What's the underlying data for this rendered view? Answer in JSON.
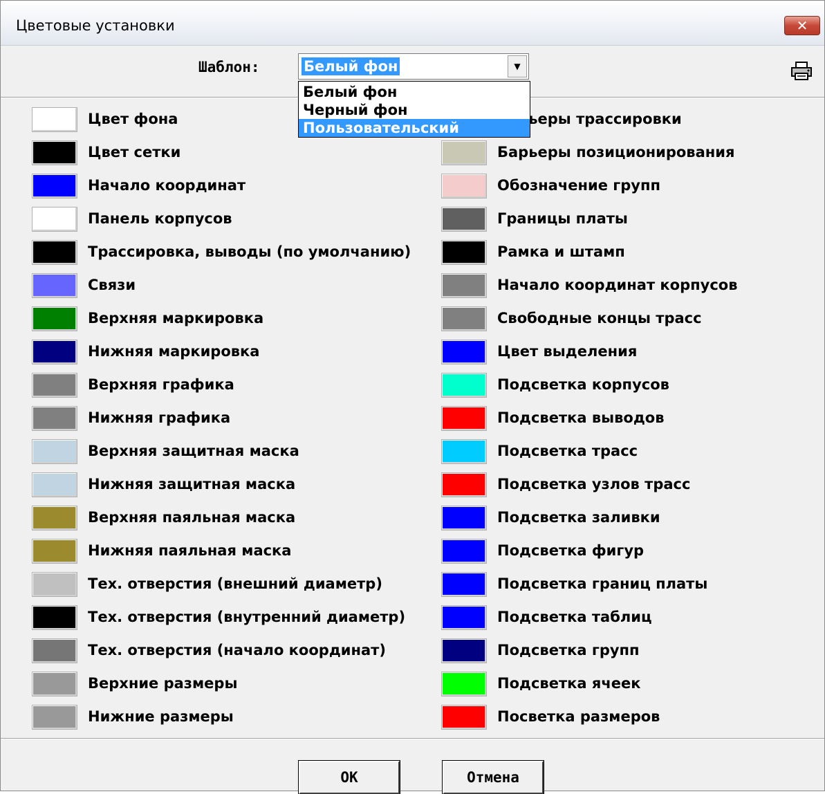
{
  "window": {
    "title": "Цветовые установки",
    "close_label": "✕"
  },
  "template": {
    "label": "Шаблон:",
    "selected_value": "Белый фон",
    "options": [
      "Белый фон",
      "Черный фон",
      "Пользовательский"
    ],
    "highlighted_option": "Пользовательский"
  },
  "left_items": [
    {
      "label": "Цвет фона",
      "color": "#ffffff"
    },
    {
      "label": "Цвет сетки",
      "color": "#000000"
    },
    {
      "label": "Начало координат",
      "color": "#0000ff"
    },
    {
      "label": "Панель корпусов",
      "color": "#ffffff"
    },
    {
      "label": "Трассировка, выводы (по умолчанию)",
      "color": "#000000"
    },
    {
      "label": "Связи",
      "color": "#6666ff"
    },
    {
      "label": "Верхняя маркировка",
      "color": "#008000"
    },
    {
      "label": "Нижняя маркировка",
      "color": "#000080"
    },
    {
      "label": "Верхняя графика",
      "color": "#808080"
    },
    {
      "label": "Нижняя графика",
      "color": "#808080"
    },
    {
      "label": "Верхняя защитная маска",
      "color": "#c0d4e2"
    },
    {
      "label": "Нижняя защитная маска",
      "color": "#c0d4e2"
    },
    {
      "label": "Верхняя паяльная маска",
      "color": "#9c8a2e"
    },
    {
      "label": "Нижняя паяльная маска",
      "color": "#9c8a2e"
    },
    {
      "label": "Тех. отверстия (внешний диаметр)",
      "color": "#c0c0c0"
    },
    {
      "label": "Тех. отверстия (внутренний диаметр)",
      "color": "#000000"
    },
    {
      "label": "Тех. отверстия (начало координат)",
      "color": "#767676"
    },
    {
      "label": "Верхние размеры",
      "color": "#999999"
    },
    {
      "label": "Нижние размеры",
      "color": "#999999"
    }
  ],
  "right_items": [
    {
      "label": "Барьеры трассировки",
      "color": "#c8c8b4"
    },
    {
      "label": "Барьеры позиционирования",
      "color": "#c8c8b4"
    },
    {
      "label": "Обозначение групп",
      "color": "#f5cccc"
    },
    {
      "label": "Границы платы",
      "color": "#606060"
    },
    {
      "label": "Рамка и штамп",
      "color": "#000000"
    },
    {
      "label": "Начало координат корпусов",
      "color": "#808080"
    },
    {
      "label": "Свободные концы трасс",
      "color": "#808080"
    },
    {
      "label": "Цвет выделения",
      "color": "#0000ff"
    },
    {
      "label": "Подсветка корпусов",
      "color": "#00ffcc"
    },
    {
      "label": "Подсветка выводов",
      "color": "#ff0000"
    },
    {
      "label": "Подсветка трасс",
      "color": "#00ccff"
    },
    {
      "label": "Подсветка узлов трасс",
      "color": "#ff0000"
    },
    {
      "label": "Подсветка заливки",
      "color": "#0000ff"
    },
    {
      "label": "Подсветка фигур",
      "color": "#0000ff"
    },
    {
      "label": "Подсветка границ платы",
      "color": "#0000ff"
    },
    {
      "label": "Подсветка таблиц",
      "color": "#0000ff"
    },
    {
      "label": "Подсветка групп",
      "color": "#000080"
    },
    {
      "label": "Подсветка ячеек",
      "color": "#00ff00"
    },
    {
      "label": "Посветка размеров",
      "color": "#ff0000"
    }
  ],
  "buttons": {
    "ok": "OK",
    "cancel": "Отмена"
  }
}
